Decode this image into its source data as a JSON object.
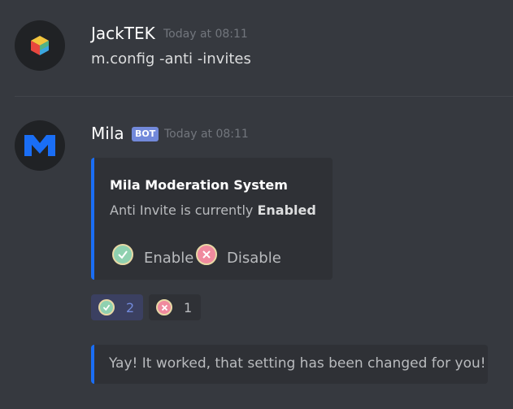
{
  "messages": [
    {
      "username": "JackTEK",
      "timestamp": "Today at 08:11",
      "content": "m.config -anti -invites"
    },
    {
      "username": "Mila",
      "bot_tag": "BOT",
      "timestamp": "Today at 08:11",
      "embed": {
        "title": "Mila Moderation System",
        "description_prefix": "Anti Invite is currently ",
        "description_bold": "Enabled",
        "options": [
          {
            "emoji": "check-emoji",
            "label": "Enable"
          },
          {
            "emoji": "cross-emoji",
            "label": "Disable"
          }
        ],
        "accent_color": "#1a6ef5"
      },
      "reactions": [
        {
          "emoji": "check-emoji",
          "count": "2",
          "active": true
        },
        {
          "emoji": "cross-emoji",
          "count": "1",
          "active": false
        }
      ],
      "followup_embed": {
        "text": "Yay! It worked, that setting has been changed for you!"
      }
    }
  ],
  "colors": {
    "background": "#36393f",
    "embed_background": "#2f3136",
    "bot_tag": "#7289da",
    "username": "#ffffff",
    "timestamp": "#72767d"
  }
}
